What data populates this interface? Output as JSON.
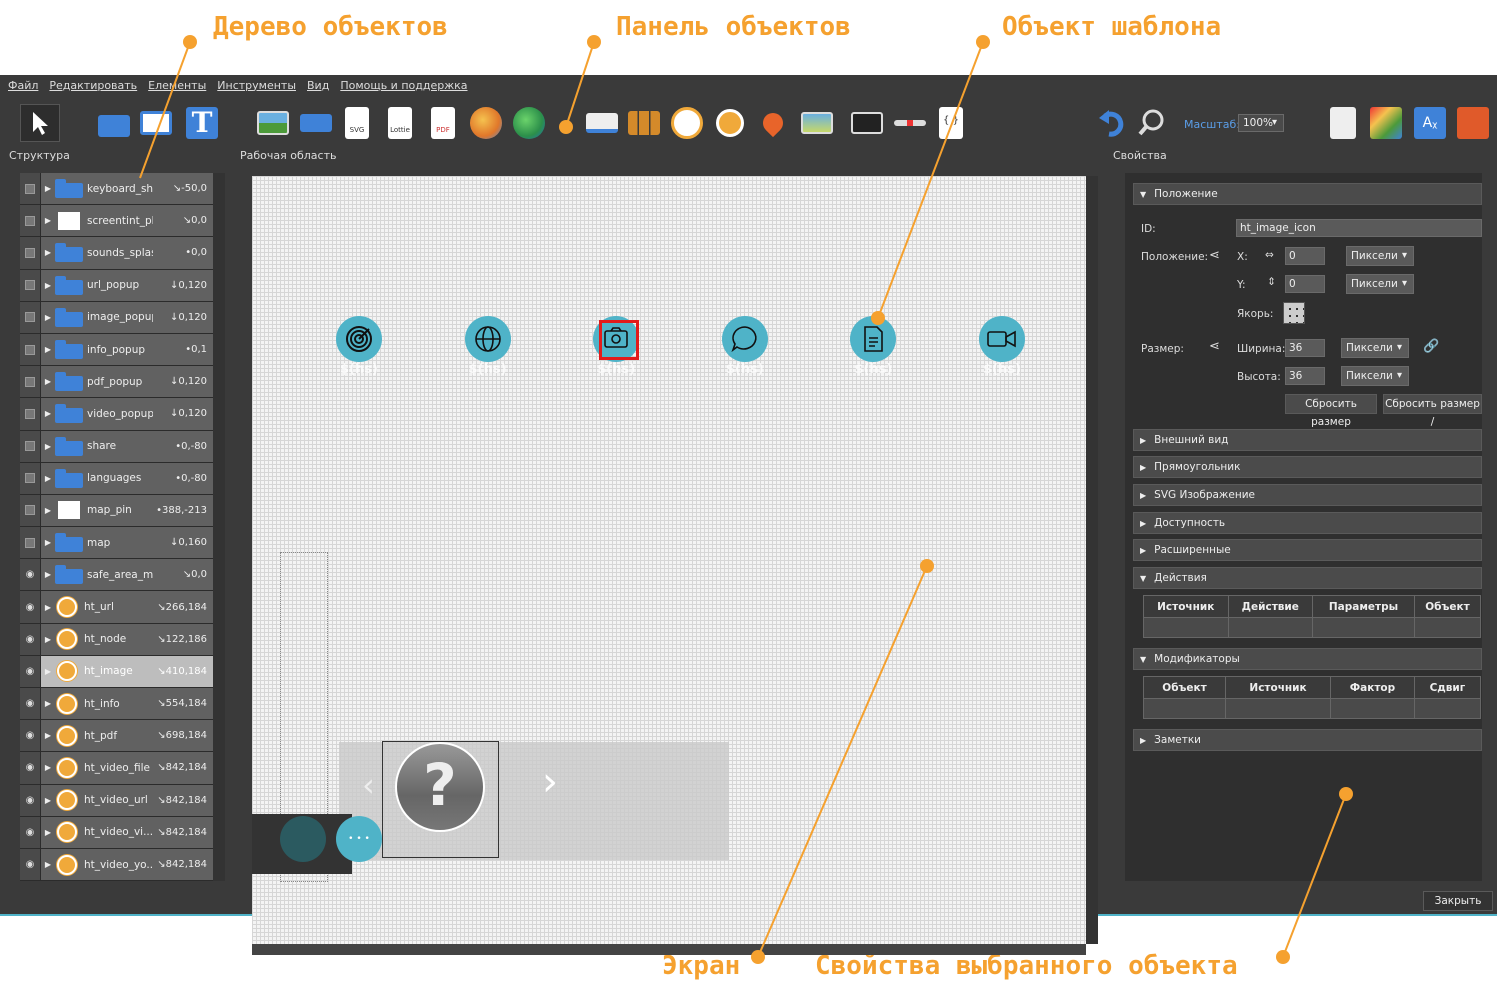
{
  "callouts": {
    "tree": "Дерево объектов",
    "objects_panel": "Панель объектов",
    "template_object": "Объект шаблона",
    "screen": "Экран",
    "properties": "Свойства выбранного объекта"
  },
  "menu": [
    "Файл",
    "Редактировать",
    "Елементы",
    "Инструменты",
    "Вид",
    "Помощь и поддержка"
  ],
  "labels": {
    "structure": "Структура",
    "workspace": "Рабочая область",
    "properties": "Свойства",
    "zoom_label": "Масштаб:",
    "zoom_value": "100%",
    "close": "Закрыть"
  },
  "toolbar_icons": [
    "pointer-tool-icon",
    "folder-tool-icon",
    "rectangle-tool-icon",
    "text-tool-icon",
    "image-tool-icon",
    "hotspot-tool-icon",
    "svg-tool-icon",
    "lottie-tool-icon",
    "pdf-tool-icon",
    "video-tool-icon",
    "map-tool-icon",
    "screen-tool-icon",
    "cloner-tool-icon",
    "compass-tool-icon",
    "marker-tool-icon",
    "pin-tool-icon",
    "area-tool-icon",
    "video-player-tool-icon",
    "scrollbar-tool-icon",
    "code-tool-icon"
  ],
  "toolbar_text": {
    "svg": "SVG",
    "lottie": "Lottie",
    "pdf": "PDF",
    "code": "{ }"
  },
  "tree": [
    {
      "name": "keyboard_short...",
      "coords": "↘-50,0",
      "icon": "folder",
      "eye": false,
      "selected": false
    },
    {
      "name": "screentint_phone",
      "coords": "↘0,0",
      "icon": "white",
      "eye": false,
      "selected": false
    },
    {
      "name": "sounds_splashsc...",
      "coords": "•0,0",
      "icon": "folder",
      "eye": false,
      "selected": false
    },
    {
      "name": "url_popup",
      "coords": "↓0,120",
      "icon": "folder",
      "eye": false,
      "selected": false
    },
    {
      "name": "image_popup",
      "coords": "↓0,120",
      "icon": "folder",
      "eye": false,
      "selected": false
    },
    {
      "name": "info_popup",
      "coords": "•0,1",
      "icon": "folder",
      "eye": false,
      "selected": false
    },
    {
      "name": "pdf_popup",
      "coords": "↓0,120",
      "icon": "folder",
      "eye": false,
      "selected": false
    },
    {
      "name": "video_popup",
      "coords": "↓0,120",
      "icon": "folder",
      "eye": false,
      "selected": false
    },
    {
      "name": "share",
      "coords": "•0,-80",
      "icon": "folder",
      "eye": false,
      "selected": false
    },
    {
      "name": "languages",
      "coords": "•0,-80",
      "icon": "folder",
      "eye": false,
      "selected": false
    },
    {
      "name": "map_pin",
      "coords": "•388,-213",
      "icon": "white",
      "eye": false,
      "selected": false
    },
    {
      "name": "map",
      "coords": "↓0,160",
      "icon": "folder",
      "eye": false,
      "selected": false
    },
    {
      "name": "safe_area_main",
      "coords": "↘0,0",
      "icon": "folder",
      "eye": true,
      "selected": false
    },
    {
      "name": "ht_url",
      "coords": "↘266,184",
      "icon": "target",
      "eye": true,
      "selected": false
    },
    {
      "name": "ht_node",
      "coords": "↘122,186",
      "icon": "target",
      "eye": true,
      "selected": false
    },
    {
      "name": "ht_image",
      "coords": "↘410,184",
      "icon": "target",
      "eye": true,
      "selected": true
    },
    {
      "name": "ht_info",
      "coords": "↘554,184",
      "icon": "target",
      "eye": true,
      "selected": false
    },
    {
      "name": "ht_pdf",
      "coords": "↘698,184",
      "icon": "target",
      "eye": true,
      "selected": false
    },
    {
      "name": "ht_video_file",
      "coords": "↘842,184",
      "icon": "target",
      "eye": true,
      "selected": false
    },
    {
      "name": "ht_video_url",
      "coords": "↘842,184",
      "icon": "target",
      "eye": true,
      "selected": false
    },
    {
      "name": "ht_video_vi...",
      "coords": "↘842,184",
      "icon": "target",
      "eye": true,
      "selected": false
    },
    {
      "name": "ht_video_yo...",
      "coords": "↘842,184",
      "icon": "target",
      "eye": true,
      "selected": false
    }
  ],
  "canvas": {
    "hotspots": [
      {
        "icon": "target-icon",
        "sub": "$(hs)"
      },
      {
        "icon": "globe-icon",
        "sub": "$(hs)"
      },
      {
        "icon": "camera-icon",
        "sub": "$(hs)"
      },
      {
        "icon": "chat-icon",
        "sub": "$(hs)"
      },
      {
        "icon": "document-icon",
        "sub": "$(hs)"
      },
      {
        "icon": "video-camera-icon",
        "sub": "$(hs)"
      }
    ],
    "question_mark": "?",
    "dots": "• • •"
  },
  "props": {
    "section_position": "Положение",
    "id_label": "ID:",
    "id_value": "ht_image_icon",
    "position_label": "Положение:",
    "x_label": "X:",
    "x_value": "0",
    "y_label": "Y:",
    "y_value": "0",
    "unit_x": "Пиксели",
    "unit_y": "Пиксели",
    "anchor_label": "Якорь:",
    "size_label": "Размер:",
    "width_label": "Ширина:",
    "width_value": "36",
    "height_label": "Высота:",
    "height_value": "36",
    "unit_w": "Пиксели",
    "unit_h": "Пиксели",
    "reset_size": "Сбросить размер",
    "reset_size2": "Сбросить размер /",
    "sections": [
      "Внешний вид",
      "Прямоугольник",
      "SVG Изображение",
      "Доступность",
      "Расширенные"
    ],
    "actions": "Действия",
    "actions_cols": [
      "Источник",
      "Действие",
      "Параметры",
      "Объект"
    ],
    "modifiers": "Модификаторы",
    "modifiers_cols": [
      "Объект",
      "Источник",
      "Фактор",
      "Сдвиг"
    ],
    "notes": "Заметки"
  },
  "colors": {
    "accent": "#f5a12f",
    "hotspot": "#4fb3c8",
    "selection": "#e21b1b",
    "folder": "#3f82d8"
  }
}
